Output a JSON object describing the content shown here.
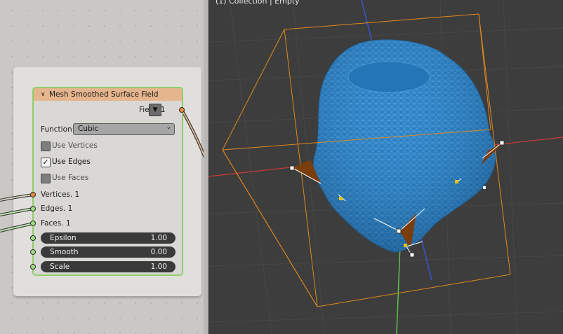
{
  "node": {
    "title": "Mesh Smoothed Surface Field",
    "output_label": "Field. 1",
    "function_label": "Function:",
    "function_value": "Cubic",
    "checkboxes": [
      {
        "label": "Use Vertices",
        "checked": false
      },
      {
        "label": "Use Edges",
        "checked": true
      },
      {
        "label": "Use Faces",
        "checked": false
      }
    ],
    "inputs": [
      "Vertices. 1",
      "Edges. 1",
      "Faces. 1"
    ],
    "fields": [
      {
        "label": "Epsilon",
        "value": "1.00"
      },
      {
        "label": "Smooth",
        "value": "0.00"
      },
      {
        "label": "Scale",
        "value": "1.00"
      }
    ]
  },
  "icons": {
    "collapse": "chevron-down-icon",
    "dropdown": "triangle-down-icon",
    "check": "checkmark-icon"
  },
  "viewport": {
    "header": "(1) Collection | Empty"
  },
  "colors": {
    "node_header": "#e5b58e",
    "node_border": "#8ed06a",
    "socket_orange": "#e58c3a",
    "socket_green": "#9ee083",
    "mesh": "#2f86c7",
    "bbox": "#e0891c",
    "x_axis": "#d23a3a",
    "y_axis": "#5cc24a",
    "z_axis": "#3555d0",
    "viewport_bg": "#3d3d3d"
  }
}
